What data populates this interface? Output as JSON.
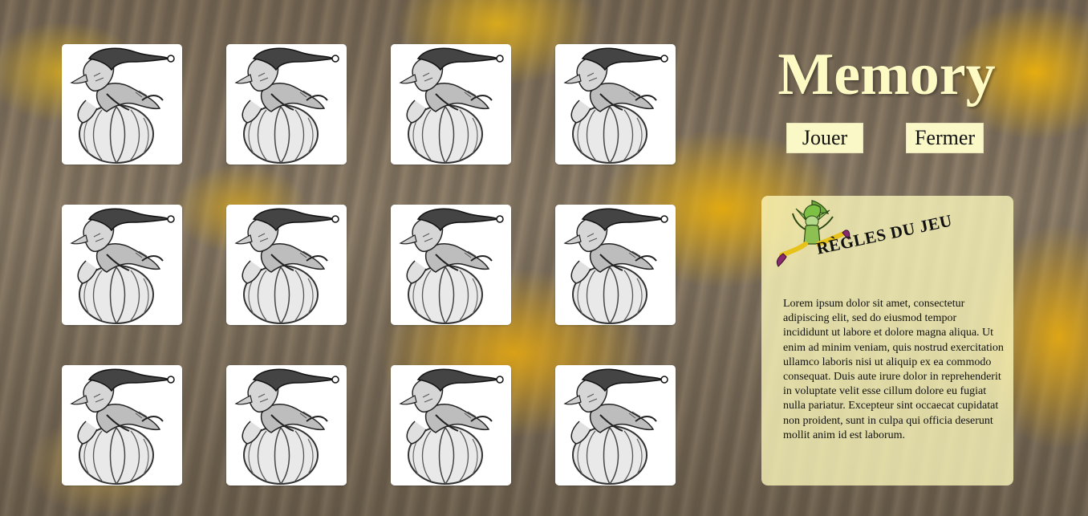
{
  "title": "Memory",
  "buttons": {
    "play": "Jouer",
    "close": "Fermer"
  },
  "rules": {
    "heading": "RÈGLES DU JEU",
    "text": "Lorem ipsum dolor sit amet, consectetur adipiscing elit, sed do eiusmod tempor incididunt ut labore et dolore magna aliqua. Ut enim ad minim veniam, quis nostrud exercitation ullamco laboris nisi ut aliquip ex ea commodo consequat. Duis aute irure dolor in reprehenderit in voluptate velit esse cillum dolore eu fugiat nulla pariatur. Excepteur sint occaecat cupidatat non proident, sunt in culpa qui officia deserunt mollit anim id est laborum."
  },
  "board": {
    "rows": 3,
    "columns": 4,
    "cards_face_down": 12,
    "card_back": "goblin-on-pumpkin-illustration"
  },
  "colors": {
    "title": "#fdfac4",
    "button_bg": "#fbf8c8",
    "panel_bg": "#fefabe"
  }
}
